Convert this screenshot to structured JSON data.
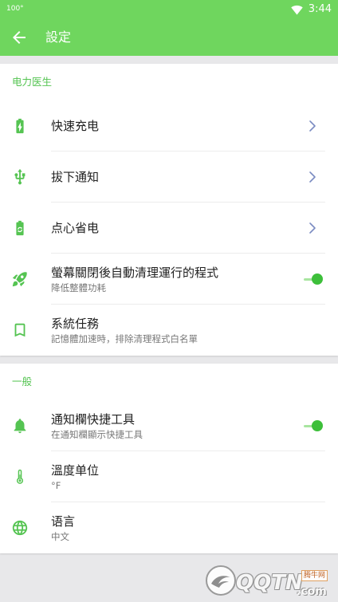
{
  "colors": {
    "primary": "#6fd65e",
    "accent": "#55c452",
    "background": "#e8e8ea",
    "chevron": "#7b8cc2",
    "toggle_track": "#a8e5a0",
    "toggle_knob": "#3dbf3a"
  },
  "status_bar": {
    "indicator": "100°",
    "wifi_icon": "wifi-icon",
    "time": "3:44"
  },
  "app_bar": {
    "back_icon": "arrow-left-icon",
    "title": "設定"
  },
  "sections": [
    {
      "header": "电力医生",
      "items": [
        {
          "icon": "battery-charging-icon",
          "title": "快速充电",
          "trailing_icon": "chevron-right-icon"
        },
        {
          "icon": "usb-icon",
          "title": "拔下通知",
          "trailing_icon": "chevron-right-icon"
        },
        {
          "icon": "battery-recycle-icon",
          "title": "点心省电",
          "trailing_icon": "chevron-right-icon"
        },
        {
          "icon": "rocket-icon",
          "title": "螢幕關閉後自動清理運行的程式",
          "subtitle": "降低整體功耗",
          "toggle_on": true
        },
        {
          "icon": "bookmark-icon",
          "title": "系統任務",
          "subtitle": "記憶體加速時，排除清理程式白名單"
        }
      ]
    },
    {
      "header": "一般",
      "items": [
        {
          "icon": "bell-icon",
          "title": "通知欄快捷工具",
          "subtitle": "在通知欄顯示快捷工具",
          "toggle_on": true
        },
        {
          "icon": "thermometer-icon",
          "title": "溫度单位",
          "subtitle": "°F"
        },
        {
          "icon": "globe-icon",
          "title": "语言",
          "subtitle": "中文"
        }
      ]
    }
  ],
  "watermark": {
    "logo_icon": "qqtn-logo-icon",
    "brand": "QQTN",
    "domain": ".com",
    "site_name": "腾牛网"
  }
}
